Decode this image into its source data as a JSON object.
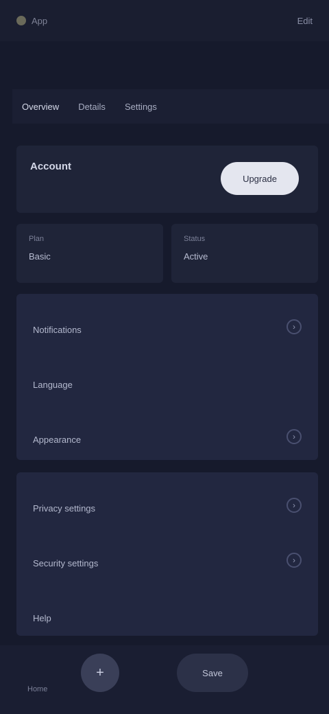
{
  "topbar": {
    "brand": "App",
    "title": "",
    "action": "Edit"
  },
  "tabs": [
    {
      "label": "Overview"
    },
    {
      "label": "Details"
    },
    {
      "label": "Settings"
    }
  ],
  "hero": {
    "title": "Account",
    "subtitle": "",
    "button_label": "Upgrade"
  },
  "stats": [
    {
      "label": "Plan",
      "value": "Basic"
    },
    {
      "label": "Status",
      "value": "Active"
    }
  ],
  "section1": {
    "rows": [
      {
        "caption": "",
        "label": "Notifications"
      },
      {
        "caption": "",
        "label": "Language"
      },
      {
        "caption": "",
        "label": "Appearance"
      }
    ]
  },
  "section2": {
    "rows": [
      {
        "caption": "",
        "label": "Privacy settings"
      },
      {
        "caption": "",
        "label": "Security settings"
      },
      {
        "caption": "",
        "label": "Help"
      }
    ]
  },
  "bottomnav": {
    "home_label": "Home",
    "center_icon": "+",
    "sub_label": "",
    "pill_label": "Save"
  }
}
